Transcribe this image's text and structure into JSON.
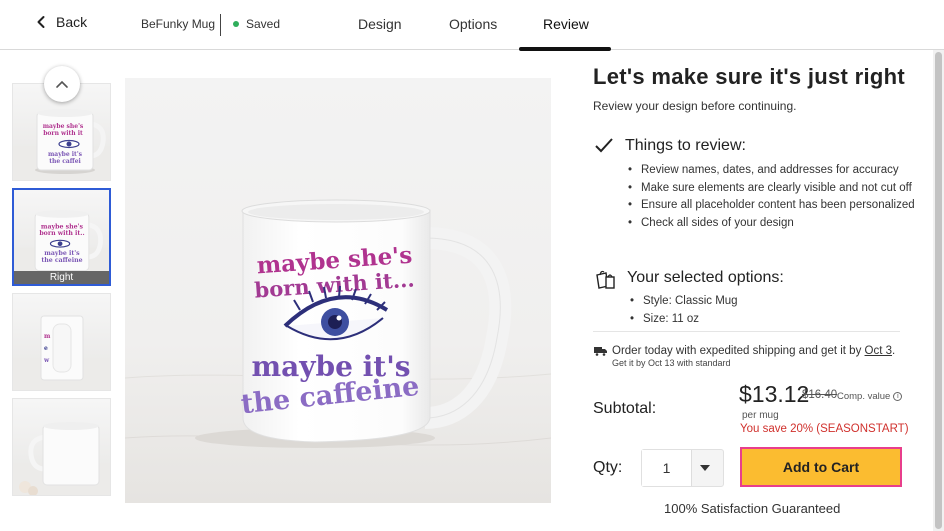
{
  "header": {
    "back_label": "Back",
    "app_name": "BeFunky Mug",
    "status": "Saved",
    "tabs": [
      {
        "label": "Design"
      },
      {
        "label": "Options"
      },
      {
        "label": "Review"
      }
    ],
    "active_tab": "Review"
  },
  "thumbnails": {
    "selected_label": "Right",
    "items": [
      {
        "view": "left"
      },
      {
        "view": "right",
        "label": "Right"
      },
      {
        "view": "front"
      },
      {
        "view": "back"
      }
    ]
  },
  "mug_art": {
    "line1": "maybe she's",
    "line2": "born with it...",
    "line3": "maybe it's",
    "line4": "the caffeine"
  },
  "review": {
    "title": "Let's make sure it's just right",
    "subtitle": "Review your design before continuing.",
    "things_title": "Things to review:",
    "things": [
      "Review names, dates, and addresses for accuracy",
      "Make sure elements are clearly visible and not cut off",
      "Ensure all placeholder content has been personalized",
      "Check all sides of your design"
    ],
    "options_title": "Your selected options:",
    "options": [
      "Style: Classic Mug",
      "Size: 11 oz"
    ]
  },
  "shipping": {
    "main_prefix": "Order today with expedited shipping and get it by ",
    "main_date": "Oct 3",
    "main_suffix": ".",
    "standard": "Get it by Oct 13 with standard"
  },
  "pricing": {
    "subtotal_label": "Subtotal:",
    "price": "$13.12",
    "comp_price": "$16.40",
    "comp_label": "Comp. value",
    "per_unit": "per mug",
    "savings": "You save 20% (SEASONSTART)"
  },
  "cart": {
    "qty_label": "Qty:",
    "qty_value": "1",
    "add_label": "Add to Cart",
    "guarantee": "100% Satisfaction Guaranteed"
  },
  "colors": {
    "accent_yellow": "#fbbc30",
    "highlight_border": "#e83e8c",
    "savings_red": "#d0312d",
    "saved_green": "#2fae5b",
    "selected_thumb_border": "#2e5bd6"
  },
  "icons": {
    "back": "chevron-left-icon",
    "scroll_up": "chevron-up-icon",
    "review": "checkmark-icon",
    "options": "shopping-bags-icon",
    "shipping": "truck-icon",
    "info": "info-icon",
    "qty": "caret-down-icon"
  }
}
